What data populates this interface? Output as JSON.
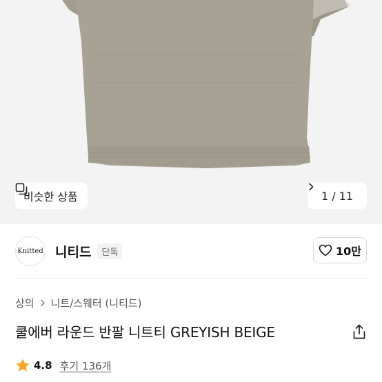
{
  "product_image": {
    "alt": "greyish beige knit tee",
    "color": "#a8a294",
    "background": "#f3f3f3"
  },
  "similar_button": {
    "label": "비슷한 상품",
    "icon": "similar-items-icon"
  },
  "pager": {
    "text": "1 / 11",
    "icon": "chevron-right-icon"
  },
  "brand": {
    "logo_text": "Knitted",
    "name": "니티드",
    "badge": "단독",
    "like_count": "10만",
    "like_icon": "heart-icon"
  },
  "breadcrumb": {
    "items": [
      "상의",
      "니트/스웨터 (니티드)"
    ],
    "separator_icon": "chevron-right-icon"
  },
  "product": {
    "title": "쿨에버 라운드 반팔 니트티 GREYISH BEIGE",
    "share_icon": "share-icon"
  },
  "rating": {
    "value": "4.8",
    "review_label": "후기 136개",
    "star_color": "#f5a623",
    "star_icon": "star-icon"
  }
}
